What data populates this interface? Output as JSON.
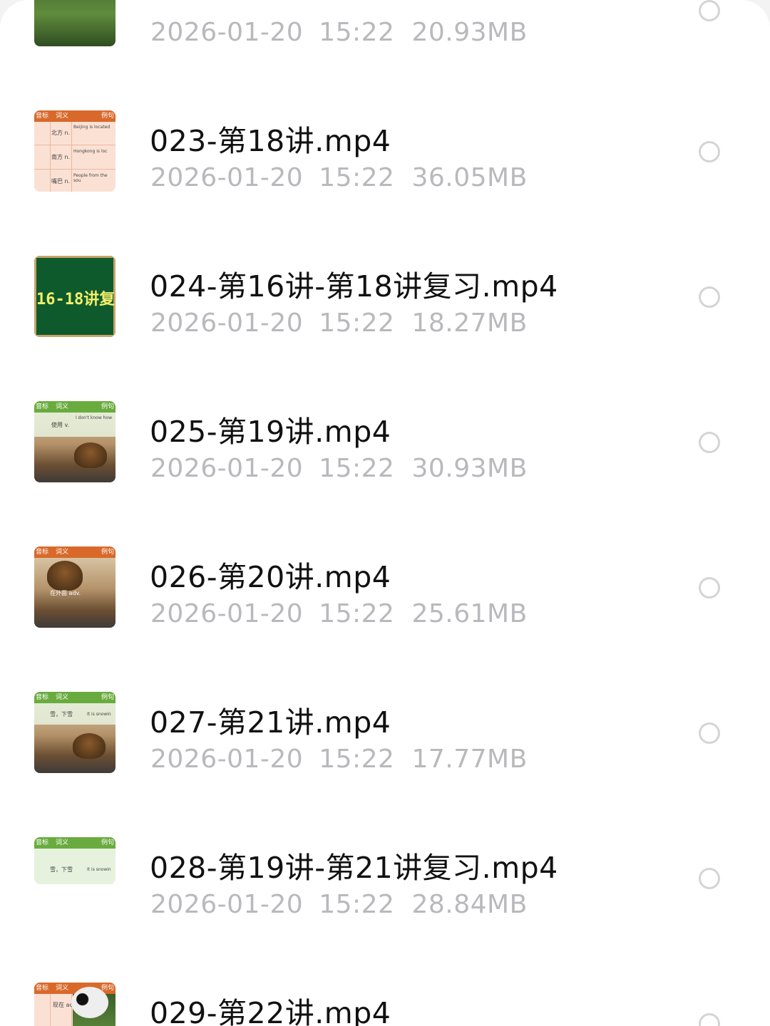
{
  "files": [
    {
      "title": "",
      "date": "2026-01-20",
      "time": "15:22",
      "size": "20.93MB"
    },
    {
      "title": "023-第18讲.mp4",
      "date": "2026-01-20",
      "time": "15:22",
      "size": "36.05MB"
    },
    {
      "title": "024-第16讲-第18讲复习.mp4",
      "date": "2026-01-20",
      "time": "15:22",
      "size": "18.27MB",
      "thumb_text": "16-18讲复"
    },
    {
      "title": "025-第19讲.mp4",
      "date": "2026-01-20",
      "time": "15:22",
      "size": "30.93MB"
    },
    {
      "title": "026-第20讲.mp4",
      "date": "2026-01-20",
      "time": "15:22",
      "size": "25.61MB"
    },
    {
      "title": "027-第21讲.mp4",
      "date": "2026-01-20",
      "time": "15:22",
      "size": "17.77MB"
    },
    {
      "title": "028-第19讲-第21讲复习.mp4",
      "date": "2026-01-20",
      "time": "15:22",
      "size": "28.84MB"
    },
    {
      "title": "029-第22讲.mp4",
      "date": "",
      "time": "",
      "size": ""
    }
  ],
  "thumbs": {
    "header_col1": "音标",
    "header_col2": "词义",
    "header_col3": "例句",
    "t023_words": [
      "北方 n.",
      "南方 n.",
      "嘴巴 n."
    ],
    "t023_examples": [
      "Beijing is located",
      "Hongkong is loc",
      "People from the sou"
    ],
    "t025_word": "使用 v.",
    "t025_example": "I don't know how",
    "t026_word": "在外面 adv.",
    "t027_word": "雪，下雪",
    "t027_example": "It is snowin",
    "t028_word": "雪，下雪",
    "t028_example": "It is snowin",
    "t029_word": "现在 adv."
  },
  "colors": {
    "title": "#111111",
    "meta": "#b9b9bd",
    "radio": "#d4d4d7",
    "orange_header": "#d9692a",
    "green_header": "#6aab3f"
  },
  "icons": {
    "select": "radio-circle-icon"
  }
}
